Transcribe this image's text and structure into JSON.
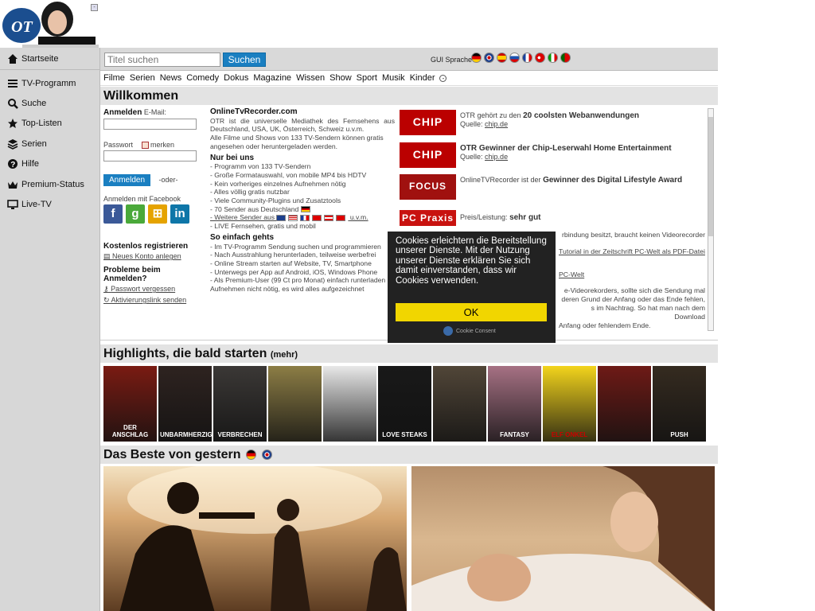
{
  "nav": {
    "items": [
      {
        "label": "Startseite",
        "icon": "home-icon"
      },
      {
        "label": "TV-Programm",
        "icon": "list-icon"
      },
      {
        "label": "Suche",
        "icon": "search-icon"
      },
      {
        "label": "Top-Listen",
        "icon": "star-icon"
      },
      {
        "label": "Serien",
        "icon": "layers-icon"
      },
      {
        "label": "Hilfe",
        "icon": "help-icon"
      },
      {
        "label": "Premium-Status",
        "icon": "crown-icon"
      },
      {
        "label": "Live-TV",
        "icon": "monitor-icon"
      }
    ]
  },
  "search": {
    "placeholder": "Titel suchen",
    "button": "Suchen"
  },
  "gui_language_label": "GUI Sprache",
  "categories": [
    "Filme",
    "Serien",
    "News",
    "Comedy",
    "Dokus",
    "Magazine",
    "Wissen",
    "Show",
    "Sport",
    "Musik",
    "Kinder"
  ],
  "welcome": {
    "title": "Willkommen",
    "login": {
      "heading": "Anmelden",
      "email_label": "E-Mail:",
      "password_label": "Passwort",
      "remember": "merken",
      "button": "Anmelden",
      "or": "-oder-",
      "facebook": "Anmelden mit Facebook",
      "register_heading": "Kostenlos registrieren",
      "register_link": "Neues Konto anlegen",
      "problems_heading": "Probleme beim Anmelden?",
      "forgot": "Passwort vergessen",
      "activation": "Aktivierungslink senden"
    },
    "intro": {
      "title": "OnlineTvRecorder.com",
      "p1": "OTR ist die universelle Mediathek des Fernsehens aus Deutschland, USA, UK, Österreich, Schweiz u.v.m.",
      "p2": "Alle Filme und Shows von 133 TV-Sendern können gratis angesehen oder heruntergeladen werden.",
      "nurbei_heading": "Nur bei uns",
      "nurbei": [
        "- Programm von 133 TV-Sendern",
        "- Große Formatauswahl, von mobile MP4 bis HDTV",
        "- Kein vorheriges einzelnes Aufnehmen nötig",
        "- Alles völlig gratis nutzbar",
        "- Viele Community-Plugins und Zusatztools",
        "- 70 Sender aus Deutschland",
        "- Weitere Sender aus",
        "- LIVE Fernsehen, gratis und mobil"
      ],
      "uvm": "u.v.m.",
      "einfach_heading": "So einfach gehts",
      "einfach": [
        "- Im TV-Programm Sendung suchen und programmieren",
        "- Nach Ausstrahlung herunterladen, teilweise werbefrei",
        "- Online Stream starten auf Website, TV, Smartphone",
        "- Unterwegs per App auf Android, iOS, Windows Phone",
        "- Als Premium-User (99 Ct pro Monat) einfach runterladen",
        "Aufnehmen nicht nötig, es wird alles aufgezeichnet"
      ]
    },
    "awards": [
      {
        "logo": "CHIP",
        "pre": "OTR gehört zu den",
        "bold": "20 coolsten Webanwendungen",
        "source_label": "Quelle:",
        "source": "chip.de"
      },
      {
        "logo": "CHIP",
        "pre": "",
        "bold": "OTR Gewinner der Chip-Leserwahl Home Entertainment",
        "source_label": "Quelle:",
        "source": "chip.de"
      },
      {
        "logo": "FOCUS",
        "pre": "OnlineTVRecorder ist der",
        "bold": "Gewinner des Digital Lifestyle Award",
        "source_label": "",
        "source": ""
      },
      {
        "logo": "PC Praxis",
        "pre": "Preis/Leistung:",
        "bold": "sehr gut",
        "source_label": "",
        "source": ""
      }
    ],
    "more_lines": [
      "rbindung besitzt, braucht keinen Videorecorder",
      "Tutorial in der Zeitschrift PC-Welt als PDF-Datei",
      "PC-Welt",
      "e-Videorekorders, sollte sich die Sendung mal",
      "deren Grund der Anfang oder das Ende fehlen,",
      "s im Nachtrag. So hat man nach dem Download",
      "Anfang oder fehlendem Ende."
    ]
  },
  "cookie": {
    "text": "Cookies erleichtern die Bereitstellung unserer Dienste. Mit der Nutzung unserer Dienste erklären Sie sich damit einverstanden, dass wir Cookies verwenden.",
    "ok": "OK",
    "consent": "Cookie Consent"
  },
  "highlights": {
    "title": "Highlights, die bald starten",
    "more": "(mehr)",
    "posters": [
      {
        "title": "DER ANSCHLAG",
        "color": "#7a1b12"
      },
      {
        "title": "UNBARMHERZIGEN",
        "color": "#2e2320"
      },
      {
        "title": "VERBRECHEN",
        "color": "#3b3836"
      },
      {
        "title": "",
        "color": "#8c7d45"
      },
      {
        "title": "",
        "color": "#e8e8e8"
      },
      {
        "title": "LOVE STEAKS",
        "color": "#191919"
      },
      {
        "title": "",
        "color": "#514638"
      },
      {
        "title": "FANTASY",
        "color": "#a67184"
      },
      {
        "title": "ELF ONKEL",
        "color": "#f3d41c"
      },
      {
        "title": "",
        "color": "#6e1a16"
      },
      {
        "title": "PUSH",
        "color": "#352b20"
      }
    ]
  },
  "beste": {
    "title": "Das Beste von gestern"
  },
  "colors": {
    "accent": "#1a7fc1",
    "cookie_bg": "#222222",
    "cookie_btn": "#f1d600",
    "sidebar": "#d7d7d7"
  }
}
